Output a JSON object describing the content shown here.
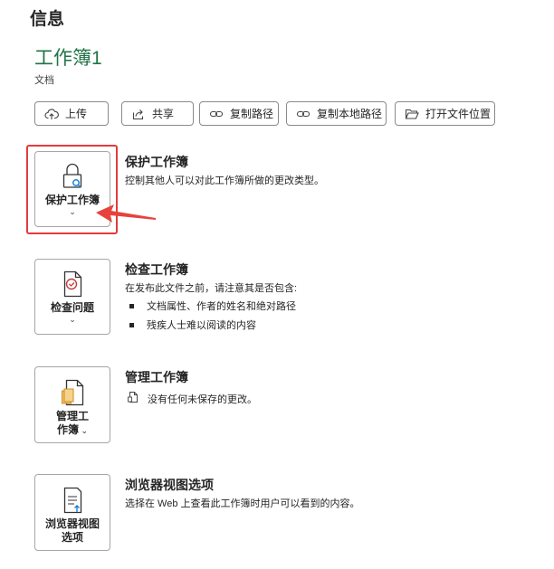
{
  "header": {
    "title": "信息"
  },
  "workbook": {
    "name": "工作簿1",
    "location": "文档"
  },
  "actions": [
    {
      "label": "上传",
      "icon": "cloud-upload-icon"
    },
    {
      "label": "共享",
      "icon": "share-icon"
    },
    {
      "label": "复制路径",
      "icon": "link-icon"
    },
    {
      "label": "复制本地路径",
      "icon": "link-icon"
    },
    {
      "label": "打开文件位置",
      "icon": "folder-open-icon"
    }
  ],
  "sections": {
    "protect": {
      "button_label": "保护工作簿",
      "title": "保护工作簿",
      "description": "控制其他人可以对此工作簿所做的更改类型。",
      "icon": "lock-icon"
    },
    "inspect": {
      "button_label": "检查问题",
      "title": "检查工作簿",
      "description": "在发布此文件之前，请注意其是否包含:",
      "bullets": [
        "文档属性、作者的姓名和绝对路径",
        "残疾人士难以阅读的内容"
      ],
      "icon": "inspect-document-icon"
    },
    "manage": {
      "button_label_line1": "管理工",
      "button_label_line2": "作簿",
      "title": "管理工作簿",
      "description": "没有任何未保存的更改。",
      "icon": "manage-workbook-icon"
    },
    "browser": {
      "button_label_line1": "浏览器视图",
      "button_label_line2": "选项",
      "title": "浏览器视图选项",
      "description": "选择在 Web 上查看此工作簿时用户可以看到的内容。",
      "icon": "browser-view-icon"
    }
  },
  "colors": {
    "accent_green": "#217346",
    "highlight_red": "#e23b3b",
    "arrow_red": "#e8413c"
  }
}
